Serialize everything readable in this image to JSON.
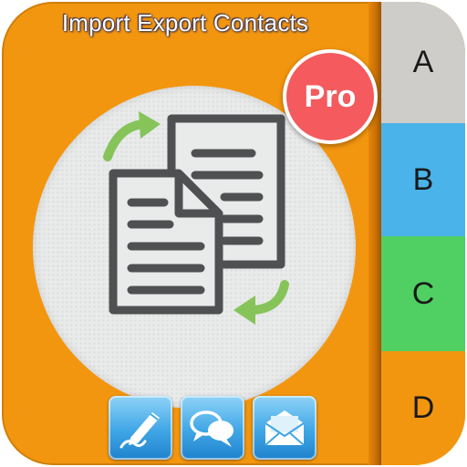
{
  "app": {
    "title": "Import Export Contacts",
    "badge": "Pro",
    "tabs": [
      "A",
      "B",
      "C",
      "D"
    ]
  },
  "icons": {
    "center": "documents-exchange-icon",
    "arrows": "green-arrow-icon",
    "buttons": [
      "pen-edit-icon",
      "chat-bubbles-icon",
      "mail-envelope-icon"
    ]
  },
  "colors": {
    "background": "#f3960f",
    "tab_a": "#cfcdca",
    "tab_b": "#4ab3ea",
    "tab_c": "#50cf62",
    "tab_d": "#f3960f",
    "badge": "#f45a5e",
    "document": "#4f5052",
    "arrow": "#86c45a",
    "button": "#3fa6e6"
  }
}
